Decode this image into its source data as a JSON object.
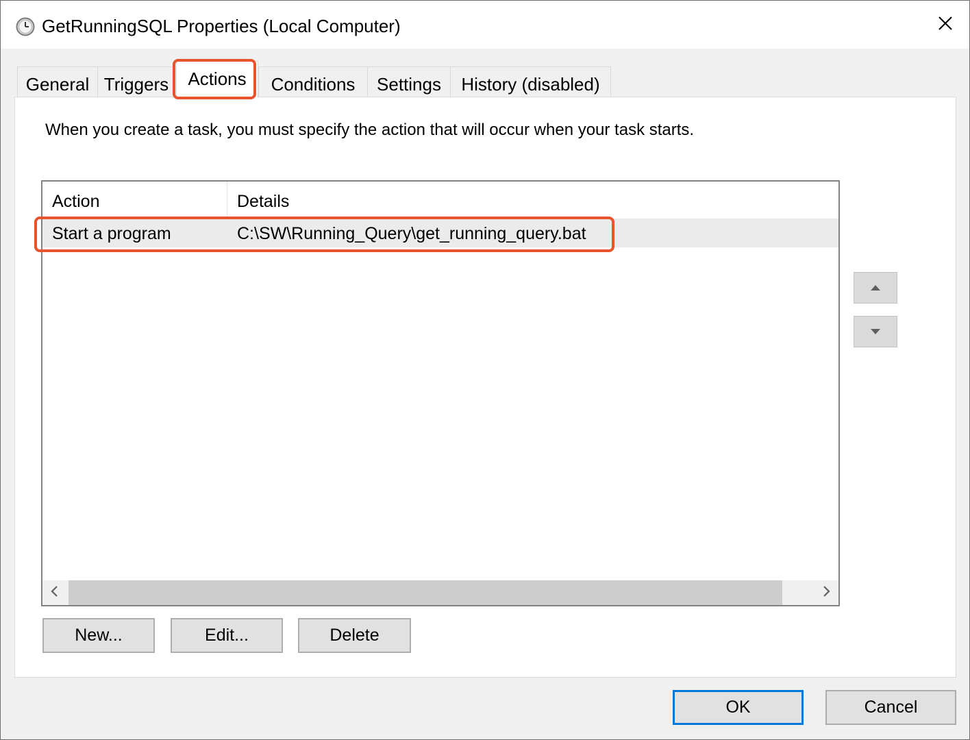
{
  "window": {
    "title": "GetRunningSQL Properties (Local Computer)",
    "title_icon": "clock-icon",
    "close_icon": "close-icon"
  },
  "tabs": [
    {
      "label": "General",
      "active": false
    },
    {
      "label": "Triggers",
      "active": false
    },
    {
      "label": "Actions",
      "active": true
    },
    {
      "label": "Conditions",
      "active": false
    },
    {
      "label": "Settings",
      "active": false
    },
    {
      "label": "History (disabled)",
      "active": false
    }
  ],
  "actions_tab": {
    "instructions": "When you create a task, you must specify the action that will occur when your task starts.",
    "columns": [
      "Action",
      "Details"
    ],
    "rows": [
      {
        "action": "Start a program",
        "details": "C:\\SW\\Running_Query\\get_running_query.bat"
      }
    ],
    "buttons": {
      "new": "New...",
      "edit": "Edit...",
      "delete": "Delete"
    }
  },
  "footer": {
    "ok": "OK",
    "cancel": "Cancel"
  },
  "colors": {
    "highlight": "#e8542c",
    "default_button_border": "#0078d7",
    "selected_row": "#ebebeb"
  }
}
